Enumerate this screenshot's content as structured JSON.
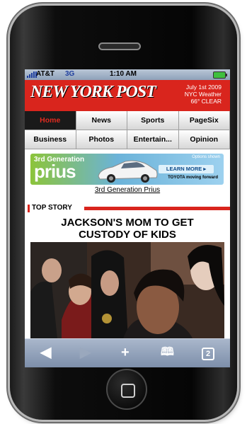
{
  "status_bar": {
    "carrier": "AT&T",
    "network": "3G",
    "time": "1:10 AM"
  },
  "masthead": {
    "logo": "NEW YORK POST",
    "date": "July 1st 2009",
    "weather_label": "NYC Weather",
    "weather_value": "66° CLEAR"
  },
  "nav": {
    "row1": [
      {
        "label": "Home",
        "active": true
      },
      {
        "label": "News"
      },
      {
        "label": "Sports"
      },
      {
        "label": "PageSix"
      }
    ],
    "row2": [
      {
        "label": "Business"
      },
      {
        "label": "Photos"
      },
      {
        "label": "Entertain..."
      },
      {
        "label": "Opinion"
      }
    ]
  },
  "ad": {
    "generation": "3rd Generation",
    "model": "prius",
    "options_text": "Options shown",
    "cta": "LEARN MORE ▸",
    "brand": "TOYOTA moving forward",
    "caption": "3rd Generation Prius"
  },
  "section": {
    "label": "TOP STORY"
  },
  "story": {
    "headline": "JACKSON'S MOM TO GET CUSTODY OF KIDS"
  },
  "colors": {
    "post_red": "#d9251d",
    "toolbar_blue": "#8a9bb4"
  },
  "toolbar_icons": [
    "back-icon",
    "forward-icon",
    "add-icon",
    "bookmarks-icon",
    "pages-icon"
  ],
  "toolbar": {
    "pages_count": "2"
  }
}
